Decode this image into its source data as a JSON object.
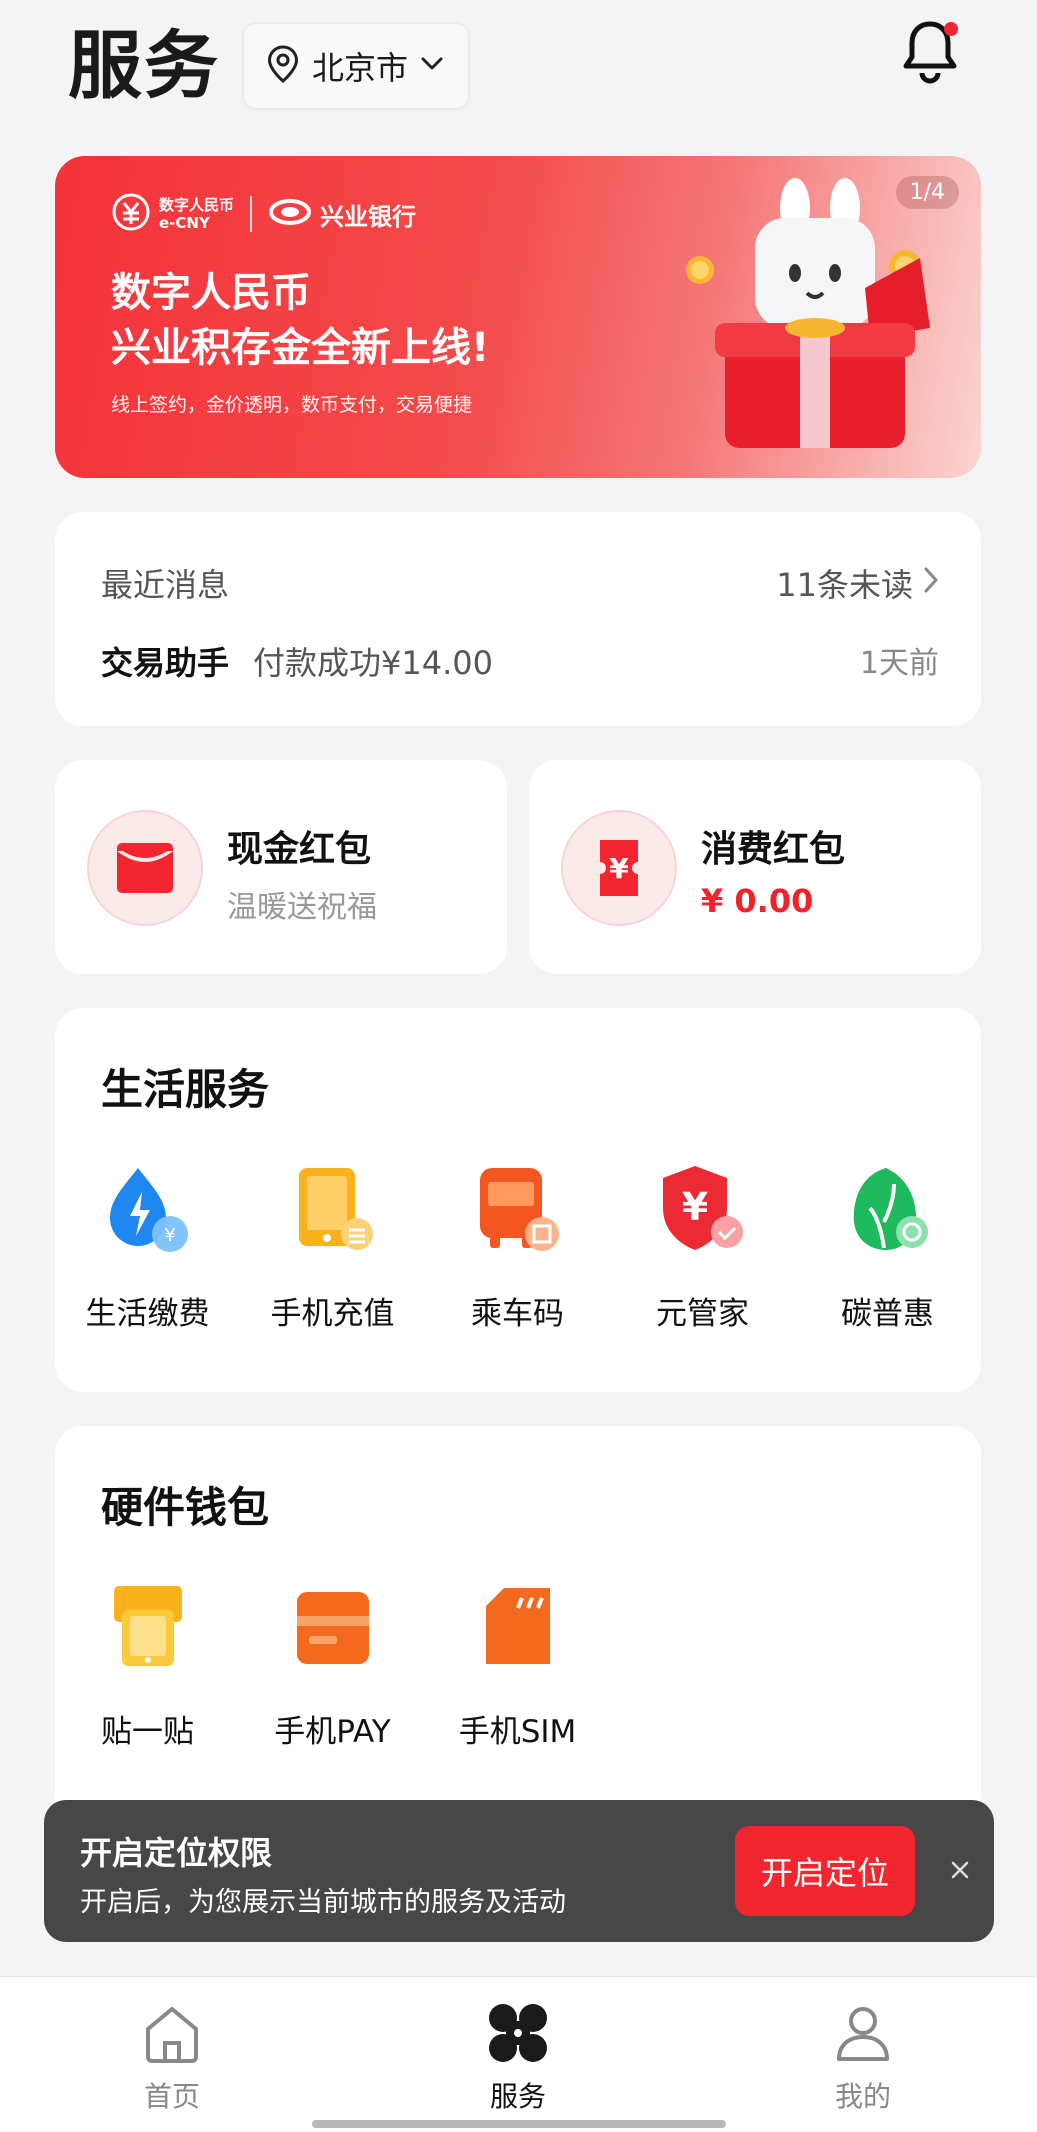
{
  "header": {
    "title": "服务",
    "city": "北京市"
  },
  "banner": {
    "logo_ecny_line1": "数字人民币",
    "logo_ecny_line2": "e-CNY",
    "logo_bank": "兴业银行",
    "headline1": "数字人民币",
    "headline2": "兴业积存金全新上线!",
    "subtitle": "线上签约，金价透明，数币支付，交易便捷",
    "page_indicator": "1/4",
    "colors": {
      "start": "#f4333a",
      "end": "#fad6d2"
    }
  },
  "messages": {
    "label": "最近消息",
    "unread": "11条未读",
    "sender": "交易助手",
    "content": "付款成功¥14.00",
    "time": "1天前"
  },
  "red_packets": [
    {
      "title": "现金红包",
      "subtitle": "温暖送祝福",
      "icon": "red-envelope-icon"
    },
    {
      "title": "消费红包",
      "amount": "¥ 0.00",
      "icon": "coupon-yuan-icon"
    }
  ],
  "life_services": {
    "title": "生活服务",
    "items": [
      {
        "label": "生活缴费",
        "icon": "utility-payment-icon"
      },
      {
        "label": "手机充值",
        "icon": "phone-recharge-icon"
      },
      {
        "label": "乘车码",
        "icon": "bus-code-icon"
      },
      {
        "label": "元管家",
        "icon": "yuan-shield-icon"
      },
      {
        "label": "碳普惠",
        "icon": "carbon-leaf-icon"
      }
    ]
  },
  "hardware_wallet": {
    "title": "硬件钱包",
    "items": [
      {
        "label": "贴一贴",
        "icon": "tap-pay-icon"
      },
      {
        "label": "手机PAY",
        "icon": "phone-pay-icon"
      },
      {
        "label": "手机SIM",
        "icon": "sim-card-icon"
      }
    ]
  },
  "location_toast": {
    "title": "开启定位权限",
    "description": "开启后，为您展示当前城市的服务及活动",
    "button": "开启定位"
  },
  "tabbar": {
    "items": [
      {
        "label": "首页",
        "icon": "home-icon",
        "active": false
      },
      {
        "label": "服务",
        "icon": "services-grid-icon",
        "active": true
      },
      {
        "label": "我的",
        "icon": "profile-icon",
        "active": false
      }
    ]
  },
  "accent_color": "#f3262f"
}
